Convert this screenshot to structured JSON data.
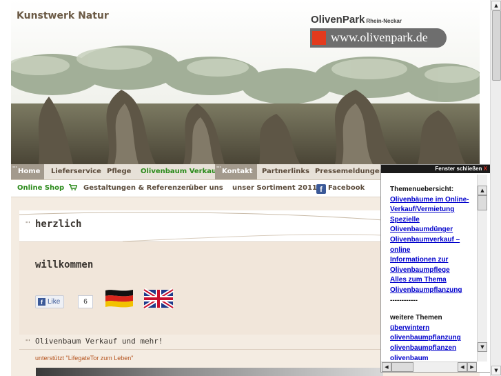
{
  "header": {
    "site_title": "Kunstwerk Natur",
    "logo_brand": "OlivenPark",
    "logo_sub": "Rhein-Neckar",
    "logo_url": "www.olivenpark.de"
  },
  "nav_main": [
    {
      "label": "Home",
      "active": true
    },
    {
      "label": "Lieferservice"
    },
    {
      "label": "Pflege"
    },
    {
      "label": "Olivenbaum Verkauf",
      "green": true
    },
    {
      "label": "Kontakt",
      "active": true
    },
    {
      "label": "Partnerlinks"
    },
    {
      "label": "Pressemeldungen"
    }
  ],
  "nav_sub": [
    {
      "label": "Online Shop",
      "green": true
    },
    {
      "label": "Gestaltungen & Referenzen"
    },
    {
      "label": "über uns"
    },
    {
      "label": "unser Sortiment 2011"
    },
    {
      "label": "Facebook"
    }
  ],
  "content": {
    "welcome_line1": "herzlich",
    "welcome_line2": "willkommen",
    "like_label": "Like",
    "like_count": "6",
    "section2_title": "Olivenbaum Verkauf und mehr!",
    "support_text": "unterstützt \"LifegateTor zum Leben\""
  },
  "popup": {
    "close_label": "Fenster schließen",
    "close_x": "X",
    "heading1": "Themenuebersicht:",
    "links1": [
      "Olivenbäume im Online-Verkauf/Vermietung",
      "Spezielle Olivenbaumdünger",
      "Olivenbaumverkauf – online",
      "Informationen zur Olivenbaumpflege",
      "Alles zum Thema Olivenbaumpflanzung"
    ],
    "separator": "------------",
    "heading2": "weitere Themen",
    "links2": [
      "überwintern olivenbaumpflanzung",
      "olivenbaumpflanzen",
      "olivenbaum"
    ]
  },
  "colors": {
    "nav_green": "#2a8a1a",
    "nav_active_bg": "#a39a8d",
    "link_blue": "#0000cc",
    "support_orange": "#b5541f",
    "popup_bar": "#1a1a1a"
  }
}
